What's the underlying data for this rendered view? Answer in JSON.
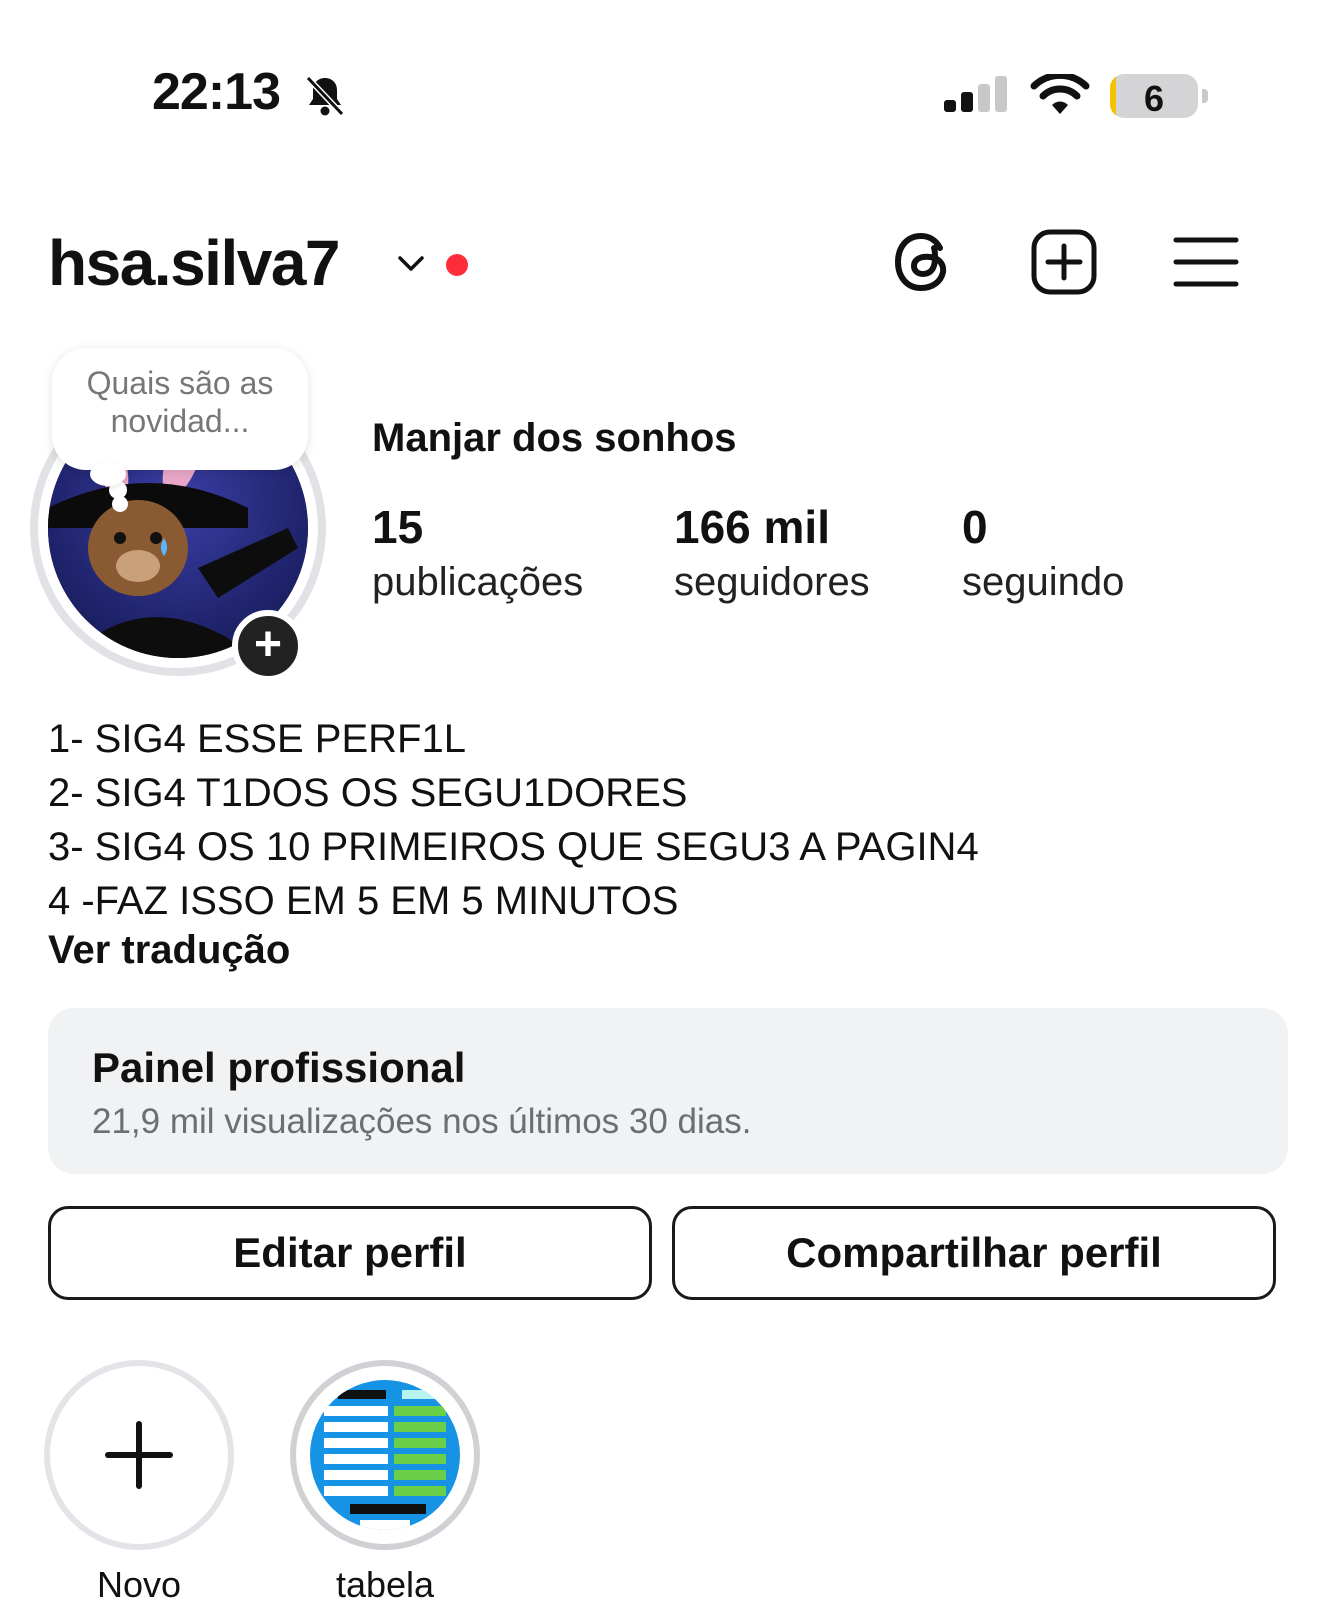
{
  "status_bar": {
    "time": "22:13",
    "battery_level": "6",
    "icons": [
      "bell-slash-icon",
      "cellular-signal-icon",
      "wifi-icon",
      "battery-icon"
    ]
  },
  "header": {
    "username": "hsa.silva7",
    "icons": [
      "chevron-down-icon",
      "threads-icon",
      "create-post-icon",
      "menu-icon"
    ],
    "notification_dot_color": "#ff2d3a"
  },
  "profile": {
    "note": "Quais são as novidad...",
    "display_name": "Manjar dos sonhos",
    "stats": [
      {
        "value": "15",
        "label": "publicações"
      },
      {
        "value": "166 mil",
        "label": "seguidores"
      },
      {
        "value": "0",
        "label": "seguindo"
      }
    ],
    "bio_lines": [
      "1- SIG4 ESSE PERF1L",
      "2- SIG4 T1DOS OS SEGU1DORES",
      "3- SIG4 OS 10 PRIMEIROS QUE SEGU3 A PAGIN4",
      "4 -FAZ ISSO EM 5 EM 5 MINUTOS"
    ],
    "translate_link": "Ver tradução"
  },
  "dashboard": {
    "title": "Painel profissional",
    "subtitle": "21,9 mil visualizações nos últimos 30 dias."
  },
  "actions": {
    "edit": "Editar perfil",
    "share": "Compartilhar perfil"
  },
  "highlights": [
    {
      "label": "Novo"
    },
    {
      "label": "tabela"
    }
  ]
}
